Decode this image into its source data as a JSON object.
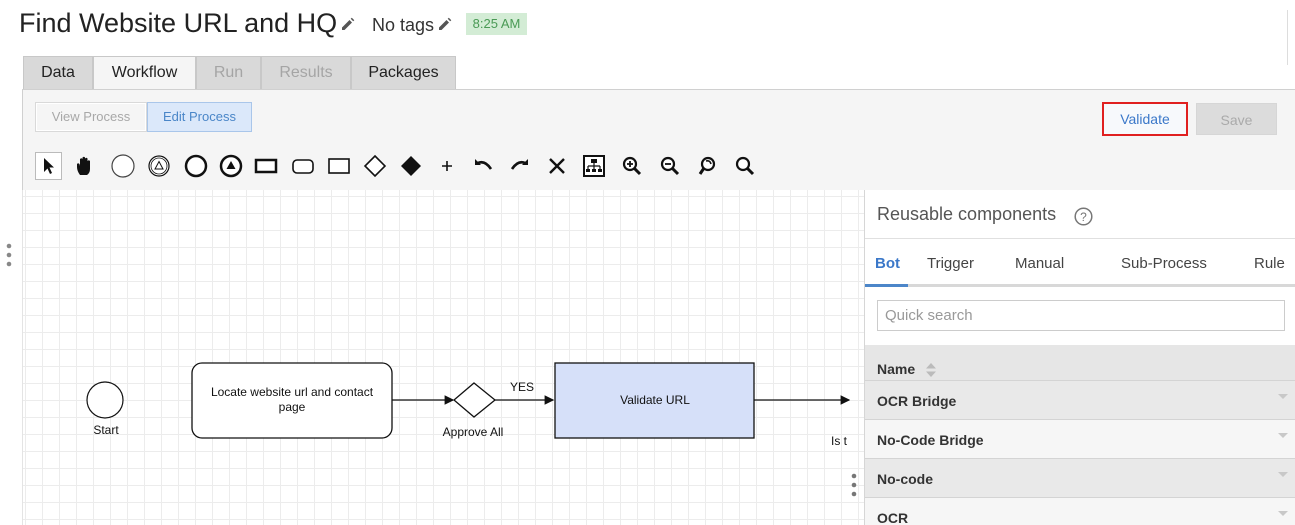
{
  "header": {
    "title": "Find Website URL and HQ",
    "tags": "No tags",
    "time": "8:25 AM"
  },
  "tabs": [
    "Data",
    "Workflow",
    "Run",
    "Results",
    "Packages"
  ],
  "mode": {
    "view_label": "View Process",
    "edit_label": "Edit Process"
  },
  "actions": {
    "validate_label": "Validate",
    "save_label": "Save"
  },
  "toolbar": {
    "icons": [
      "pointer-icon",
      "hand-icon",
      "start-event-icon",
      "intermediate-event-icon",
      "end-event-icon",
      "terminate-event-icon",
      "task-icon",
      "rounded-task-icon",
      "subprocess-icon",
      "gateway-icon",
      "filled-gateway-icon",
      "add-icon",
      "undo-icon",
      "redo-icon",
      "delete-icon",
      "layout-icon",
      "zoom-in-icon",
      "zoom-out-icon",
      "zoom-reset-icon",
      "zoom-fit-icon"
    ]
  },
  "diagram": {
    "start_label": "Start",
    "task1_label": "Locate website url and contact page",
    "gateway_label": "Approve All",
    "yes_label": "YES",
    "task2_label": "Validate URL",
    "cut_label": "Is t"
  },
  "sidepanel": {
    "title": "Reusable components",
    "tabs": [
      "Bot",
      "Trigger",
      "Manual",
      "Sub-Process",
      "Rule"
    ],
    "search_placeholder": "Quick search",
    "column_name": "Name",
    "rows": [
      "OCR Bridge",
      "No-Code Bridge",
      "No-code",
      "OCR"
    ]
  },
  "colors": {
    "accent": "#3b78c9",
    "validate_border": "#e02020",
    "time_badge_bg": "#d3ecd5",
    "task_fill": "#d6e0f9"
  }
}
